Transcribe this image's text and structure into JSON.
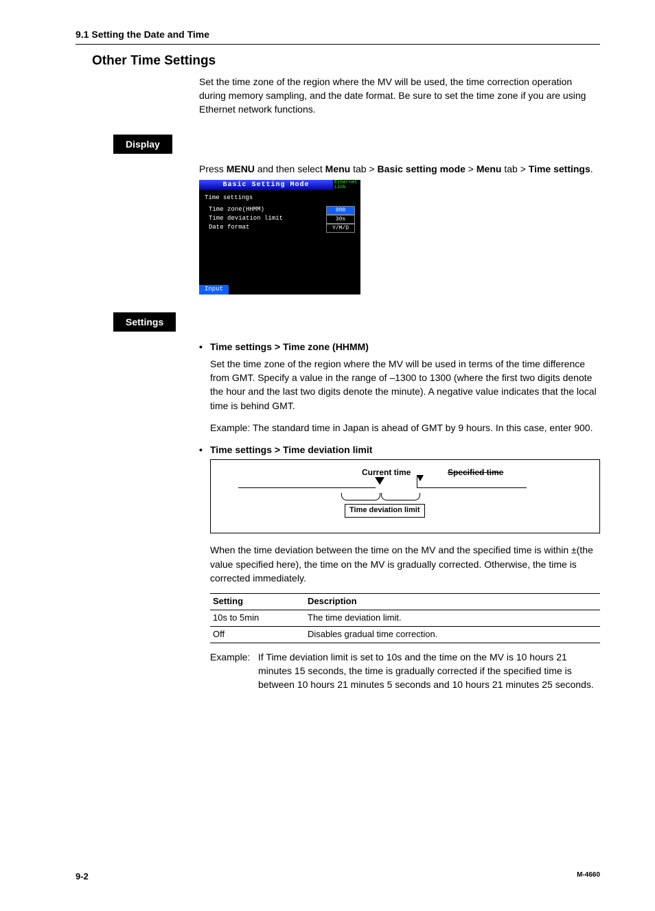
{
  "header": {
    "section": "9.1  Setting the Date and Time"
  },
  "heading": "Other Time Settings",
  "intro": "Set the time zone of the region where the MV will be used, the time correction operation during memory sampling, and the date format. Be sure to set the time zone if you are using Ethernet network functions.",
  "display": {
    "label": "Display",
    "instruction_pre": "Press ",
    "menu": "MENU",
    "instruction_mid1": " and then select ",
    "b_menu_tab": "Menu",
    "instruction_mid2": " tab > ",
    "b_basic": "Basic setting mode",
    "instruction_mid3": " > ",
    "b_menu_tab2": "Menu",
    "instruction_mid4": " tab > ",
    "b_time": "Time settings",
    "instruction_end": "."
  },
  "screenshot": {
    "title": "Basic Setting Mode",
    "badge1": "Ethernet",
    "badge2": "Link",
    "heading": "Time settings",
    "rows": [
      {
        "label": "Time zone(HHMM)",
        "value": "900",
        "selected": true
      },
      {
        "label": "Time deviation limit",
        "value": "30s",
        "selected": false
      },
      {
        "label": "Date format",
        "value": "Y/M/D",
        "selected": false
      }
    ],
    "footer": "Input"
  },
  "settings": {
    "label": "Settings",
    "item1": {
      "title": "Time settings > Time zone (HHMM)",
      "para": "Set the time zone of the region where the MV will be used in terms of the time difference from GMT. Specify a value in the range of –1300 to 1300 (where the first two digits denote the hour and the last two digits denote the minute). A negative value indicates that the local time is behind GMT.",
      "example": "Example: The standard time in Japan is ahead of GMT by 9 hours. In this case, enter 900."
    },
    "item2": {
      "title": "Time settings > Time deviation limit",
      "diagram": {
        "current": "Current time",
        "specified": "Specified time",
        "box": "Time deviation limit"
      },
      "para": "When the time deviation between the time on the MV and the specified time is within ±(the value specified here), the time on the MV is gradually corrected. Otherwise, the time is corrected immediately.",
      "table": {
        "h1": "Setting",
        "h2": "Description",
        "rows": [
          {
            "setting": "10s to 5min",
            "desc": "The time deviation limit."
          },
          {
            "setting": "Off",
            "desc": "Disables gradual time correction."
          }
        ]
      },
      "example_label": "Example:",
      "example": "If Time deviation limit is set to 10s and the time on the MV is 10 hours 21 minutes 15 seconds, the time is gradually corrected if the specified time is between 10 hours 21 minutes 5 seconds and 10 hours 21 minutes 25 seconds."
    }
  },
  "footer": {
    "page": "9-2",
    "doc": "M-4660"
  }
}
